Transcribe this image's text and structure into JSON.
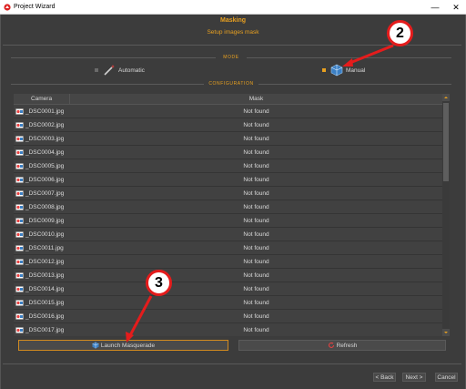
{
  "window": {
    "title": "Project Wizard",
    "minimize": "—",
    "close": "✕"
  },
  "header": {
    "title": "Masking",
    "subtitle": "Setup images mask"
  },
  "sections": {
    "mode": "MODE",
    "configuration": "CONFIGURATION"
  },
  "mode": {
    "automatic_label": "Automatic",
    "manual_label": "Manual",
    "selected": "Manual"
  },
  "table": {
    "columns": [
      "Camera",
      "Mask"
    ],
    "rows": [
      {
        "camera": "_DSC0001.jpg",
        "mask": "Not found"
      },
      {
        "camera": "_DSC0002.jpg",
        "mask": "Not found"
      },
      {
        "camera": "_DSC0003.jpg",
        "mask": "Not found"
      },
      {
        "camera": "_DSC0004.jpg",
        "mask": "Not found"
      },
      {
        "camera": "_DSC0005.jpg",
        "mask": "Not found"
      },
      {
        "camera": "_DSC0006.jpg",
        "mask": "Not found"
      },
      {
        "camera": "_DSC0007.jpg",
        "mask": "Not found"
      },
      {
        "camera": "_DSC0008.jpg",
        "mask": "Not found"
      },
      {
        "camera": "_DSC0009.jpg",
        "mask": "Not found"
      },
      {
        "camera": "_DSC0010.jpg",
        "mask": "Not found"
      },
      {
        "camera": "_DSC0011.jpg",
        "mask": "Not found"
      },
      {
        "camera": "_DSC0012.jpg",
        "mask": "Not found"
      },
      {
        "camera": "_DSC0013.jpg",
        "mask": "Not found"
      },
      {
        "camera": "_DSC0014.jpg",
        "mask": "Not found"
      },
      {
        "camera": "_DSC0015.jpg",
        "mask": "Not found"
      },
      {
        "camera": "_DSC0016.jpg",
        "mask": "Not found"
      },
      {
        "camera": "_DSC0017.jpg",
        "mask": "Not found"
      }
    ]
  },
  "actions": {
    "launch_label": "Launch Masquerade",
    "refresh_label": "Refresh"
  },
  "footer": {
    "back_label": "< Back",
    "next_label": "Next >",
    "cancel_label": "Cancel"
  },
  "callouts": {
    "manual": "2",
    "launch": "3"
  },
  "colors": {
    "accent": "#e8a020",
    "callout_red": "#e41c1c",
    "background": "#3c3c3c"
  }
}
